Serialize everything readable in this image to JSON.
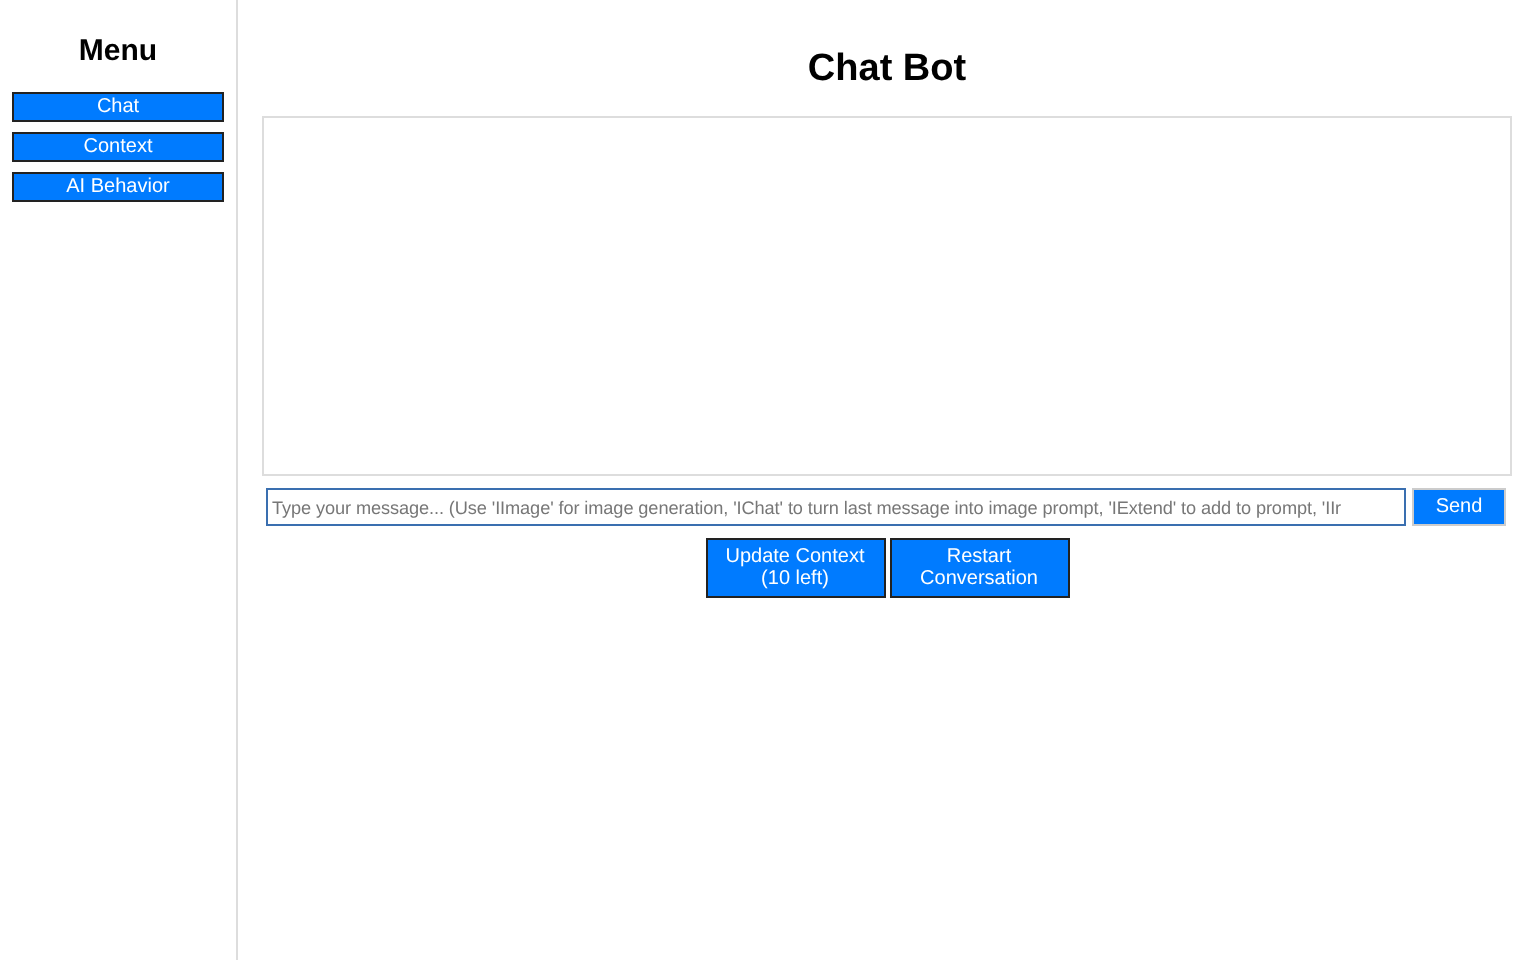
{
  "sidebar": {
    "title": "Menu",
    "items": [
      {
        "label": "Chat"
      },
      {
        "label": "Context"
      },
      {
        "label": "AI Behavior"
      }
    ]
  },
  "main": {
    "title": "Chat Bot",
    "input": {
      "placeholder": "Type your message... (Use 'IImage' for image generation, 'IChat' to turn last message into image prompt, 'IExtend' to add to prompt, 'IIr"
    },
    "send": "Send",
    "buttons": [
      [
        "Update Context",
        "(10 left)"
      ],
      [
        "Restart",
        "Conversation"
      ]
    ]
  }
}
